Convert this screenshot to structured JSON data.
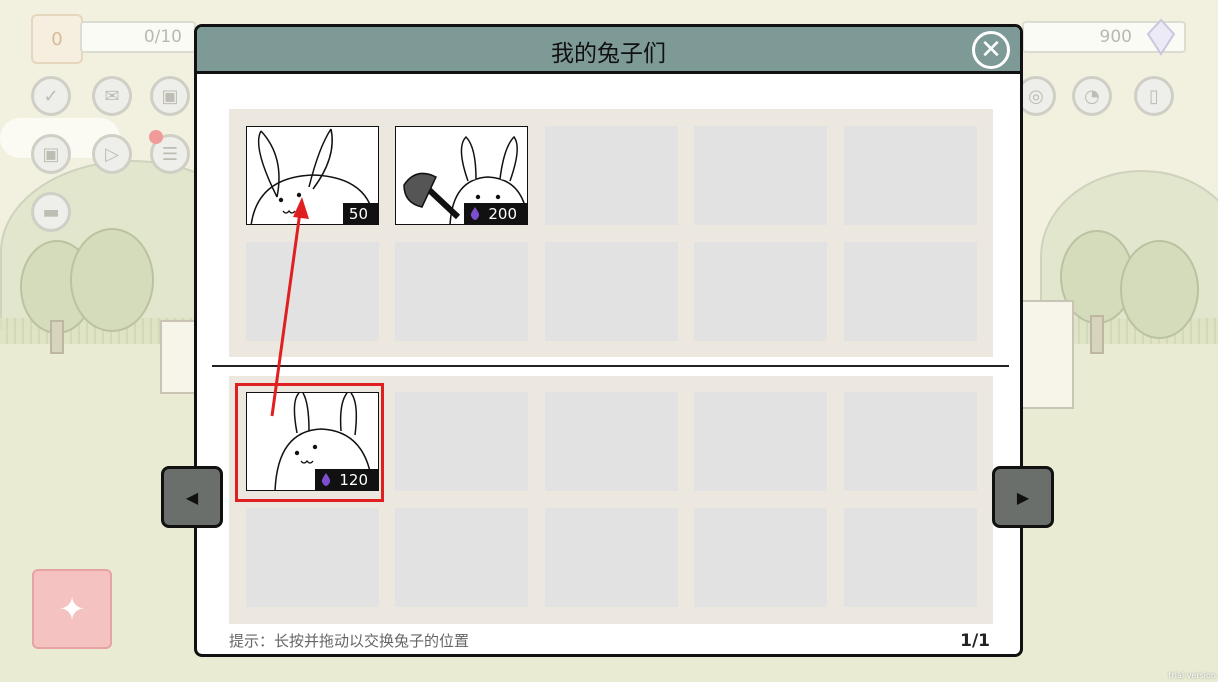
{
  "hud": {
    "level": "0",
    "progress": "0/10",
    "crystals": "900"
  },
  "modal": {
    "title": "我的兔子们",
    "hint": "提示：长按并拖动以交换兔子的位置",
    "page_indicator": "1/1"
  },
  "bunnies_top": [
    {
      "price": "50",
      "currency_icon": "none"
    },
    {
      "price": "200",
      "currency_icon": "purple-drop-icon"
    }
  ],
  "bunnies_bottom": [
    {
      "price": "120",
      "currency_icon": "purple-drop-icon"
    }
  ],
  "footer": {
    "trial": "trial version"
  },
  "colors": {
    "header": "#7e9a97",
    "highlight": "#e02020",
    "drop": "#7b4fd0"
  }
}
